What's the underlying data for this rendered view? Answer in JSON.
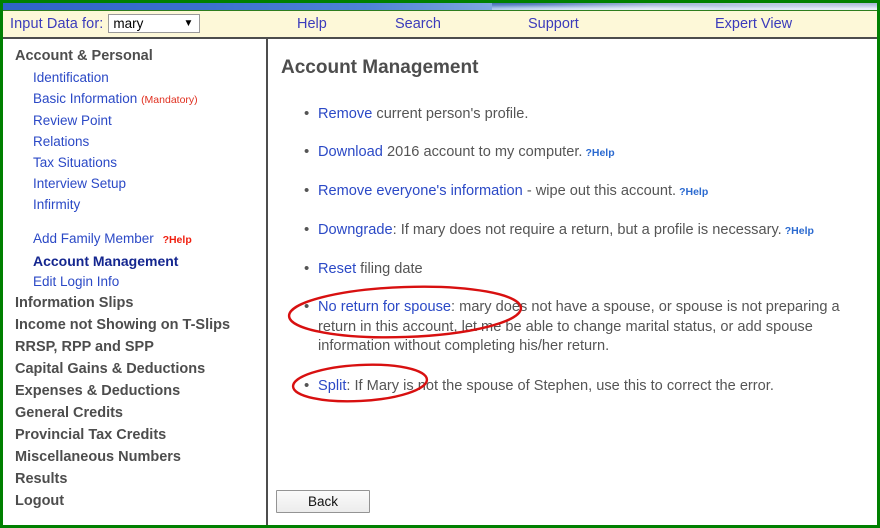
{
  "topnav": {
    "input_data_label": "Input Data for:",
    "selected_person": "mary",
    "person_options": [
      "mary"
    ],
    "dropdown_arrow": "chevron-down-icon",
    "links": [
      {
        "label": "Help"
      },
      {
        "label": "Search"
      },
      {
        "label": "Support"
      },
      {
        "label": "Expert View"
      }
    ]
  },
  "sidebar": {
    "items": [
      {
        "label": "Account & Personal",
        "type": "group"
      },
      {
        "label": "Identification",
        "type": "sub"
      },
      {
        "label": "Basic Information",
        "type": "sub",
        "note": "(Mandatory)"
      },
      {
        "label": "Review Point",
        "type": "sub"
      },
      {
        "label": "Relations",
        "type": "sub"
      },
      {
        "label": "Tax Situations",
        "type": "sub"
      },
      {
        "label": "Interview Setup",
        "type": "sub"
      },
      {
        "label": "Infirmity",
        "type": "sub"
      },
      {
        "label": "Add Family Member",
        "type": "sub",
        "help": "?Help"
      },
      {
        "label": "Account Management",
        "type": "sub-bold"
      },
      {
        "label": "Edit Login Info",
        "type": "sub"
      },
      {
        "label": "Information Slips",
        "type": "group"
      },
      {
        "label": "Income not Showing on T-Slips",
        "type": "group"
      },
      {
        "label": "RRSP, RPP and SPP",
        "type": "group"
      },
      {
        "label": "Capital Gains & Deductions",
        "type": "group"
      },
      {
        "label": "Expenses & Deductions",
        "type": "group"
      },
      {
        "label": "General Credits",
        "type": "group"
      },
      {
        "label": "Provincial Tax Credits",
        "type": "group"
      },
      {
        "label": "Miscellaneous Numbers",
        "type": "group"
      },
      {
        "label": "Results",
        "type": "group"
      },
      {
        "label": "Logout",
        "type": "group"
      }
    ]
  },
  "content": {
    "title": "Account Management",
    "actions": [
      {
        "link": "Remove",
        "rest": " current person's profile.",
        "help": ""
      },
      {
        "link": "Download",
        "rest": " 2016 account to my computer.",
        "help": "?Help"
      },
      {
        "link": "Remove everyone's information",
        "rest": " - wipe out this account.",
        "help": "?Help"
      },
      {
        "link": "Downgrade",
        "rest": ": If mary does not require a return, but a profile is necessary.",
        "help": "?Help"
      },
      {
        "link": "Reset",
        "rest": " filing date",
        "help": ""
      },
      {
        "link": "No return for spouse",
        "rest": ": mary does not have a spouse, or spouse is not preparing a return in this account, let me be able to change marital status, or add spouse information without completing his/her return.",
        "help": ""
      },
      {
        "link": "Split",
        "rest": ": If Mary is not the spouse of Stephen, use this to correct the error.",
        "help": ""
      }
    ],
    "back_label": "Back"
  },
  "annotations": [
    {
      "name": "highlight-ellipse-no-return-for-spouse"
    },
    {
      "name": "highlight-ellipse-split"
    }
  ],
  "colors": {
    "frame_green": "#008000",
    "nav_background": "#fdf8d8",
    "link_blue": "#2b49c6",
    "heading_gray": "#4d4d4d",
    "annotation_red": "#d81010",
    "mandatory_red": "#e03020"
  }
}
